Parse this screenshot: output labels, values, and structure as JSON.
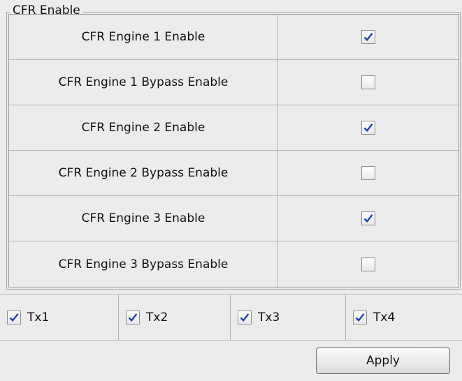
{
  "group": {
    "title": "CFR Enable"
  },
  "engines": [
    {
      "label": "CFR Engine 1 Enable",
      "checked": true
    },
    {
      "label": "CFR Engine 1 Bypass Enable",
      "checked": false
    },
    {
      "label": "CFR Engine 2 Enable",
      "checked": true
    },
    {
      "label": "CFR Engine 2 Bypass Enable",
      "checked": false
    },
    {
      "label": "CFR Engine 3 Enable",
      "checked": true
    },
    {
      "label": "CFR Engine 3 Bypass Enable",
      "checked": false
    }
  ],
  "tx": [
    {
      "label": "Tx1",
      "checked": true
    },
    {
      "label": "Tx2",
      "checked": true
    },
    {
      "label": "Tx3",
      "checked": true
    },
    {
      "label": "Tx4",
      "checked": true
    }
  ],
  "actions": {
    "apply_label": "Apply"
  },
  "colors": {
    "check_mark": "#1f3fae",
    "background": "#ececec"
  }
}
